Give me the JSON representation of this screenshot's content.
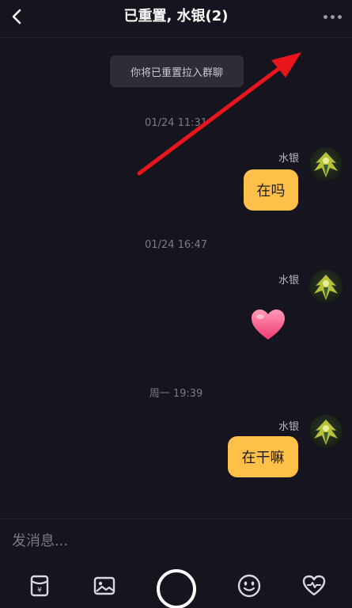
{
  "header": {
    "title": "已重置, 水银(2)"
  },
  "system_notice": "你将已重置拉入群聊",
  "messages": [
    {
      "time": "01/24 11:31",
      "sender": "水银",
      "text": "在吗"
    },
    {
      "time": "01/24 16:47",
      "sender": "水银",
      "sticker": "heart"
    },
    {
      "time": "周一 19:39",
      "sender": "水银",
      "text": "在干嘛"
    }
  ],
  "input": {
    "placeholder": "发消息..."
  },
  "toolbar": {
    "icons": [
      "red-packet-icon",
      "image-icon",
      "camera-shutter",
      "emoji-icon",
      "heart-gift-icon"
    ]
  },
  "colors": {
    "background": "#15141f",
    "bubble": "#ffc04a",
    "annotation_arrow": "#e8151b"
  }
}
